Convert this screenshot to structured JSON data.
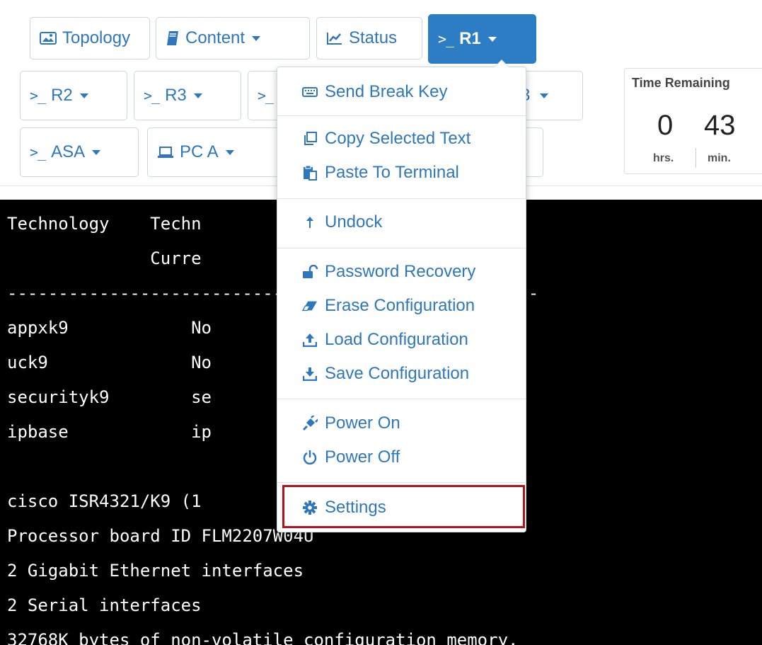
{
  "toolbar": {
    "row1": [
      {
        "label": "Topology",
        "icon": "image-icon"
      },
      {
        "label": "Content",
        "icon": "book-icon",
        "caret": true
      },
      {
        "label": "Status",
        "icon": "chart-icon"
      },
      {
        "label": "R1",
        "icon": "terminal-icon",
        "caret": true,
        "active": true
      }
    ],
    "row2": [
      {
        "label": "R2",
        "icon": "terminal-icon",
        "caret": true
      },
      {
        "label": "R3",
        "icon": "terminal-icon",
        "caret": true
      },
      {
        "label": "3",
        "caret": true
      }
    ],
    "row3": [
      {
        "label": "ASA",
        "icon": "terminal-icon",
        "caret": true
      },
      {
        "label": "PC A",
        "icon": "laptop-icon",
        "caret": true
      }
    ],
    "terminal_prompt_glyph": ">_"
  },
  "timer": {
    "title": "Time Remaining",
    "hours": "0",
    "minutes": "43",
    "hours_unit": "hrs.",
    "minutes_unit": "min."
  },
  "terminal": {
    "lines": [
      "Technology    Techn                    Technology-",
      "              Curre                    Next reboot",
      "----------------------------------------------------",
      "appxk9            No               e           Non",
      "uck9              No               e           Non",
      "securityk9        se              manent       sec",
      "ipbase            ip              manent       ipb",
      "",
      "cisco ISR4321/K9 (1               1648789K/6147K b",
      "Processor board ID FLM2207W04U",
      "2 Gigabit Ethernet interfaces",
      "2 Serial interfaces",
      "32768K bytes of non-volatile configuration memory."
    ]
  },
  "menu": {
    "items": [
      {
        "label": "Send Break Key",
        "icon": "keyboard-icon"
      },
      {
        "label": "Copy Selected Text",
        "icon": "copy-icon"
      },
      {
        "label": "Paste To Terminal",
        "icon": "paste-icon"
      },
      {
        "label": "Undock",
        "icon": "undock-arrow-icon"
      },
      {
        "label": "Password Recovery",
        "icon": "unlock-icon"
      },
      {
        "label": "Erase Configuration",
        "icon": "eraser-icon"
      },
      {
        "label": "Load Configuration",
        "icon": "upload-icon"
      },
      {
        "label": "Save Configuration",
        "icon": "download-icon"
      },
      {
        "label": "Power On",
        "icon": "plug-icon"
      },
      {
        "label": "Power Off",
        "icon": "power-icon"
      },
      {
        "label": "Settings",
        "icon": "gear-icon"
      }
    ]
  },
  "colors": {
    "accent": "#2f77bd",
    "active_button": "#2d7dc4",
    "highlight_border": "#b3131a",
    "terminal_bg": "#000000"
  }
}
